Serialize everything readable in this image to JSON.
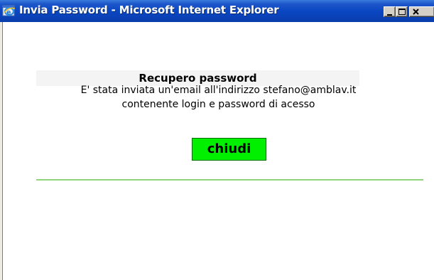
{
  "window": {
    "title": "Invia Password - Microsoft Internet Explorer",
    "icon": "internet-explorer-icon",
    "controls": {
      "minimize": "minimize-icon",
      "maximize": "maximize-icon",
      "close": "close-icon"
    }
  },
  "page": {
    "heading": "Recupero password",
    "message_line1": "E' stata inviata un'email all'indirizzo stefano@amblav.it",
    "message_line2": "contenente login e password di acesso",
    "close_button_label": "chiudi"
  },
  "colors": {
    "titlebar": "#0a47c2",
    "button_background": "#00f000",
    "divider": "#8fd37a",
    "heading_background": "#f4f4f4"
  }
}
